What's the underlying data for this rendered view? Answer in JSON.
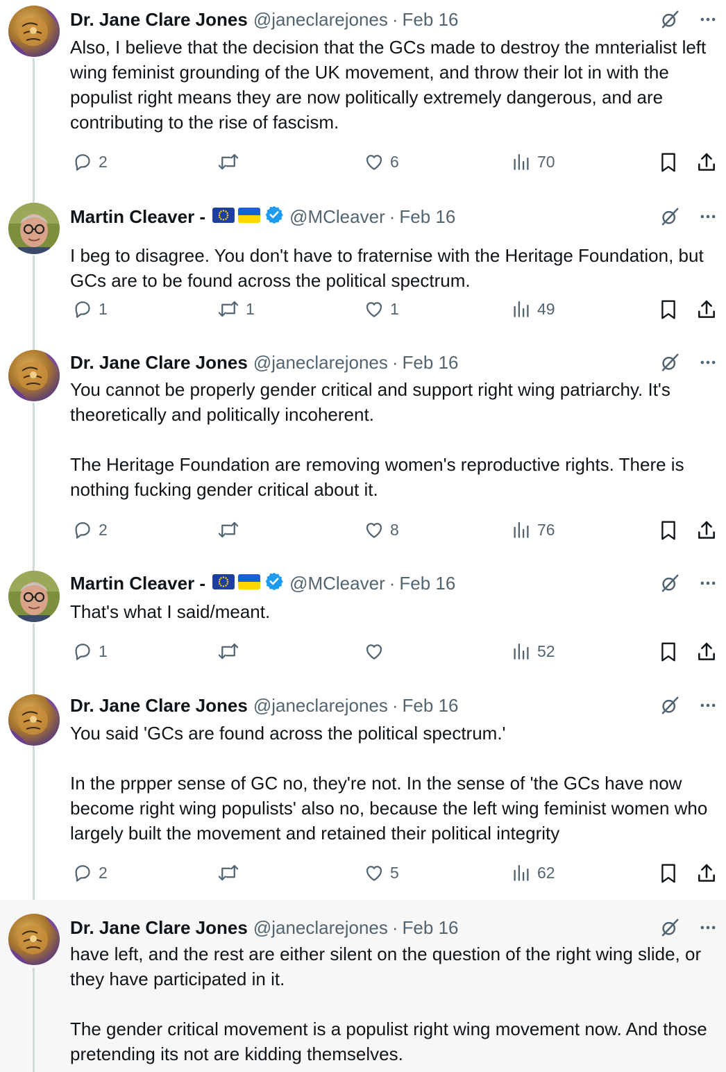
{
  "tweets": [
    {
      "author": "Dr. Jane Clare Jones",
      "handle": "@janeclarejones",
      "separator": "·",
      "date": "Feb 16",
      "avatar": "jane",
      "verified": false,
      "paragraphs": [
        "Also, I believe that the decision that the GCs made to destroy the mnterialist left wing feminist grounding of the UK movement, and throw their lot in with the populist right means they are now politically extremely dangerous, and are contributing to the rise of fascism."
      ],
      "replies": "2",
      "reposts": "",
      "likes": "6",
      "views": "70"
    },
    {
      "author": "Martin Cleaver -",
      "handle": "@MCleaver",
      "separator": "·",
      "date": "Feb 16",
      "avatar": "martin",
      "verified": true,
      "flags": [
        "eu-flag-icon",
        "ukraine-flag-icon"
      ],
      "paragraphs": [
        "I beg to disagree. You don't have to fraternise with the Heritage Foundation, but GCs are to be found across the political spectrum."
      ],
      "replies": "1",
      "reposts": "1",
      "likes": "1",
      "views": "49"
    },
    {
      "author": "Dr. Jane Clare Jones",
      "handle": "@janeclarejones",
      "separator": "·",
      "date": "Feb 16",
      "avatar": "jane",
      "verified": false,
      "paragraphs": [
        "You cannot be properly gender critical and support right wing patriarchy. It's theoretically and politically incoherent.",
        "The Heritage Foundation are removing women's reproductive rights. There is nothing fucking gender critical about it."
      ],
      "replies": "2",
      "reposts": "",
      "likes": "8",
      "views": "76"
    },
    {
      "author": "Martin Cleaver -",
      "handle": "@MCleaver",
      "separator": "·",
      "date": "Feb 16",
      "avatar": "martin",
      "verified": true,
      "flags": [
        "eu-flag-icon",
        "ukraine-flag-icon"
      ],
      "paragraphs": [
        "That's what I said/meant."
      ],
      "replies": "1",
      "reposts": "",
      "likes": "",
      "views": "52"
    },
    {
      "author": "Dr. Jane Clare Jones",
      "handle": "@janeclarejones",
      "separator": "·",
      "date": "Feb 16",
      "avatar": "jane",
      "verified": false,
      "paragraphs": [
        "You said 'GCs are found across the political spectrum.'",
        "In the prpper sense of GC no, they're not. In the sense of 'the GCs have now become right wing populists' also no, because the left wing feminist women who largely built the movement and retained their political integrity"
      ],
      "replies": "2",
      "reposts": "",
      "likes": "5",
      "views": "62"
    },
    {
      "author": "Dr. Jane Clare Jones",
      "handle": "@janeclarejones",
      "separator": "·",
      "date": "Feb 16",
      "avatar": "jane",
      "verified": false,
      "highlight": true,
      "paragraphs": [
        "have left, and the rest are either silent on the question of the right wing slide, or they have participated in it.",
        "The gender critical movement is a populist right wing movement now. And those pretending its not are kidding themselves."
      ],
      "no_actions": true
    }
  ],
  "colors": {
    "text": "#0f1419",
    "muted": "#536471",
    "thread_line": "#cfd9de",
    "verified": "#1d9bf0",
    "highlight_bg": "#f7f7f7"
  }
}
